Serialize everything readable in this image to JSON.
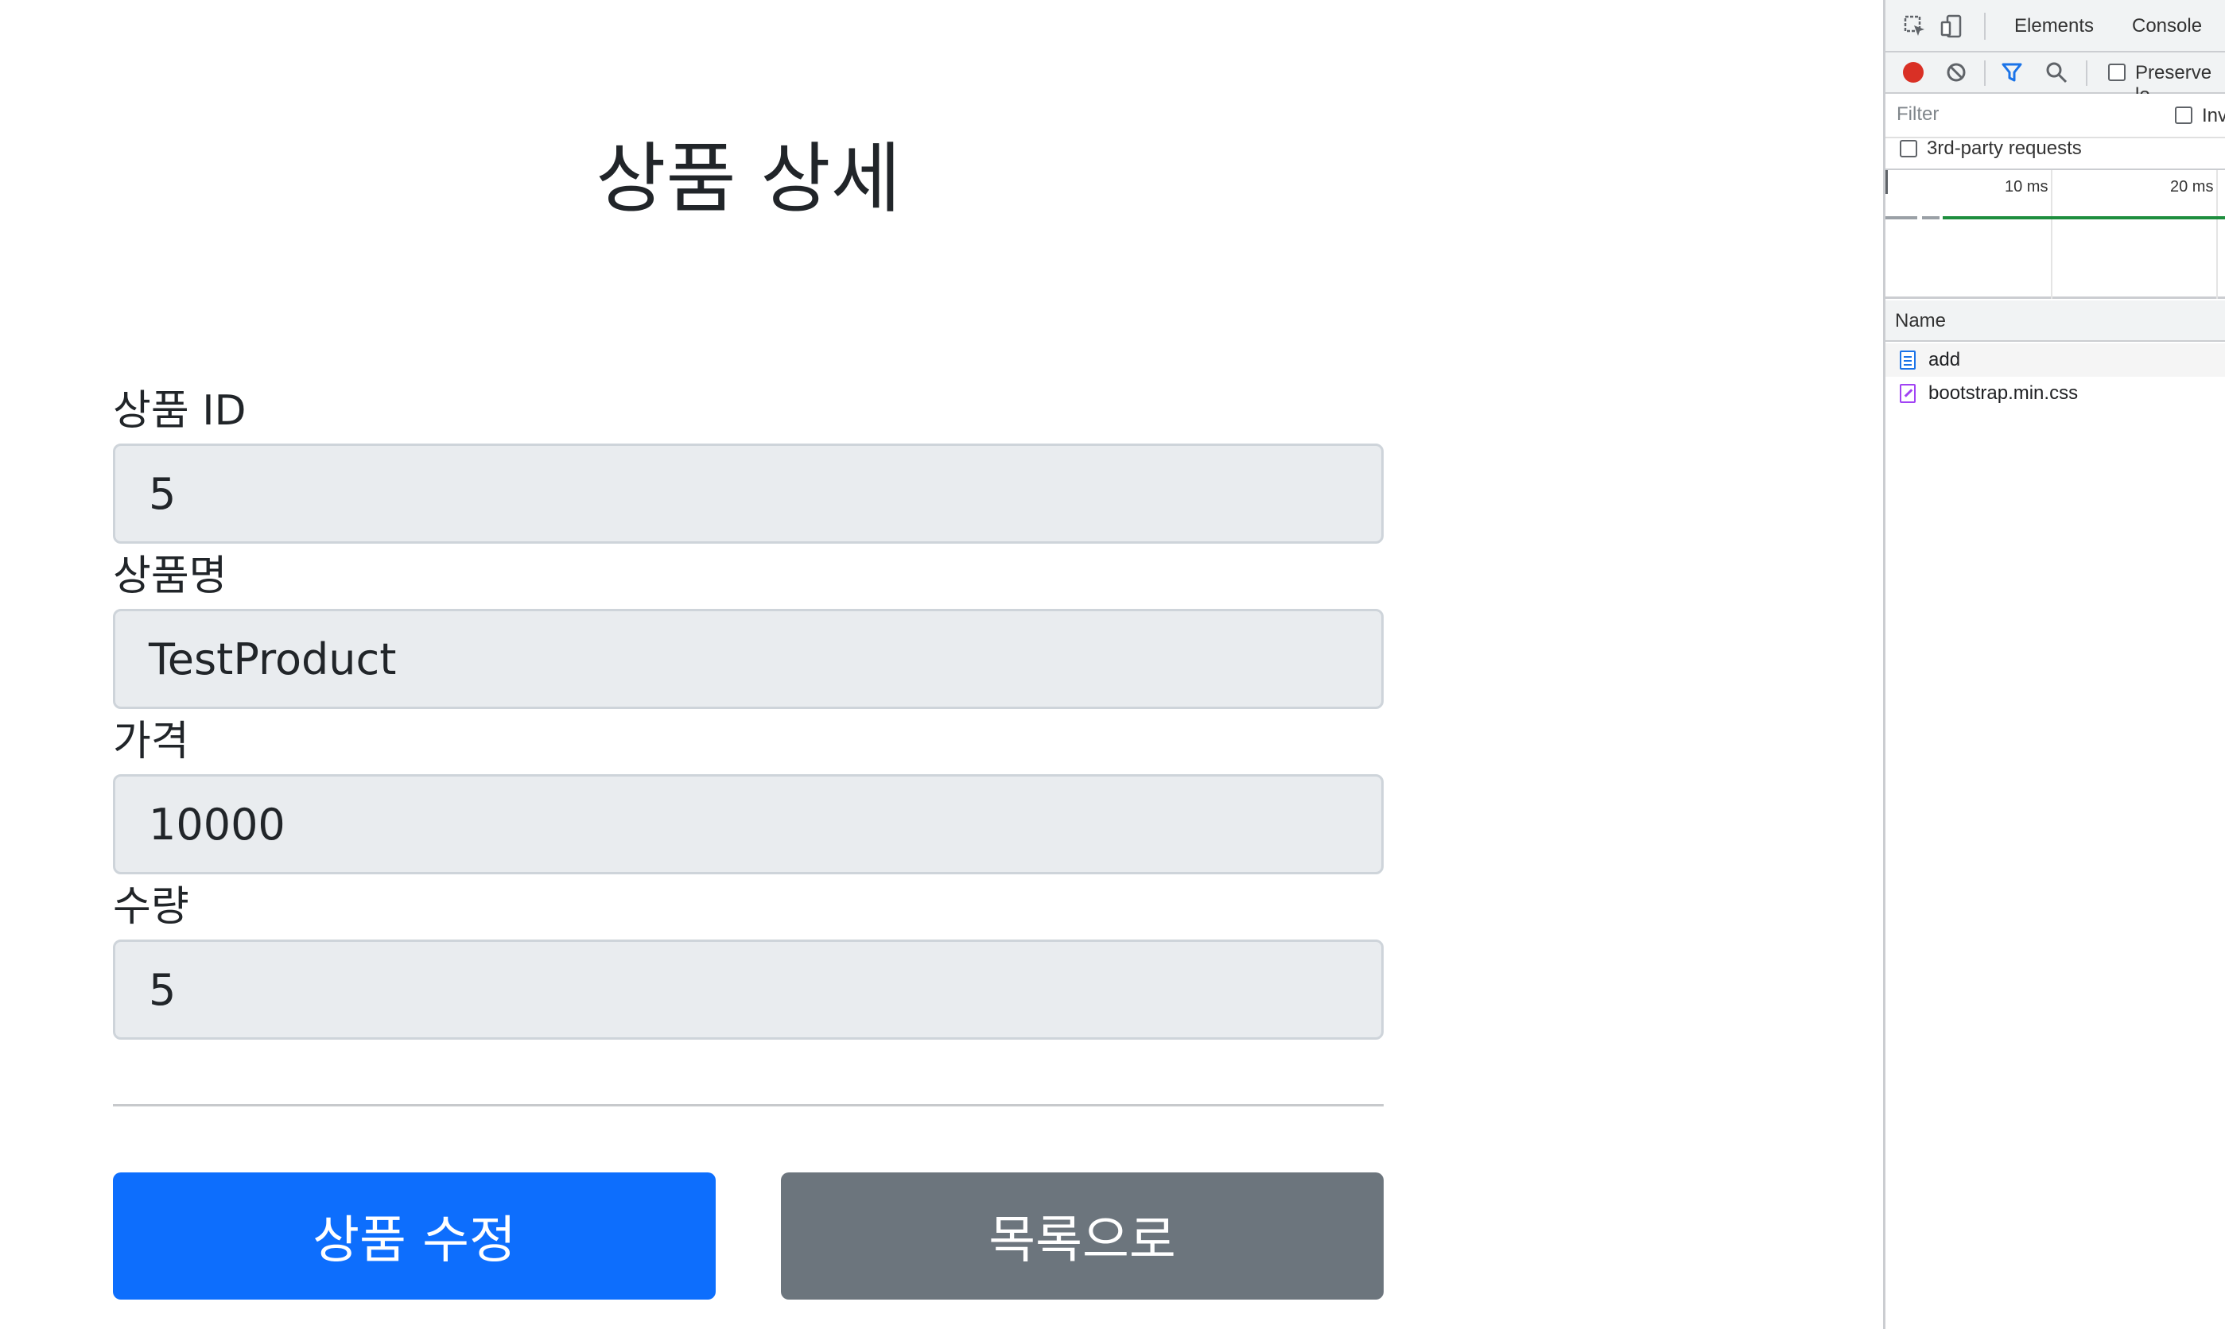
{
  "page": {
    "title": "상품 상세",
    "fields": [
      {
        "label": "상품 ID",
        "value": "5"
      },
      {
        "label": "상품명",
        "value": "TestProduct"
      },
      {
        "label": "가격",
        "value": "10000"
      },
      {
        "label": "수량",
        "value": "5"
      }
    ],
    "buttons": {
      "edit": "상품 수정",
      "list": "목록으로"
    },
    "colors": {
      "primary": "#0d6efd",
      "secondary": "#6c757d",
      "input_bg": "#e9ecef"
    }
  },
  "devtools": {
    "tabs": [
      "Elements",
      "Console"
    ],
    "preserve_log": "Preserve lo",
    "filter_placeholder": "Filter",
    "invert": "Inv",
    "third_party": "3rd-party requests",
    "timeline_ticks": [
      "10 ms",
      "20 ms"
    ],
    "name_header": "Name",
    "requests": [
      {
        "name": "add",
        "icon": "document-icon"
      },
      {
        "name": "bootstrap.min.css",
        "icon": "stylesheet-icon"
      }
    ],
    "icons": [
      "inspect-element-icon",
      "device-toolbar-icon",
      "record-icon",
      "clear-icon",
      "filter-icon",
      "search-icon"
    ]
  }
}
